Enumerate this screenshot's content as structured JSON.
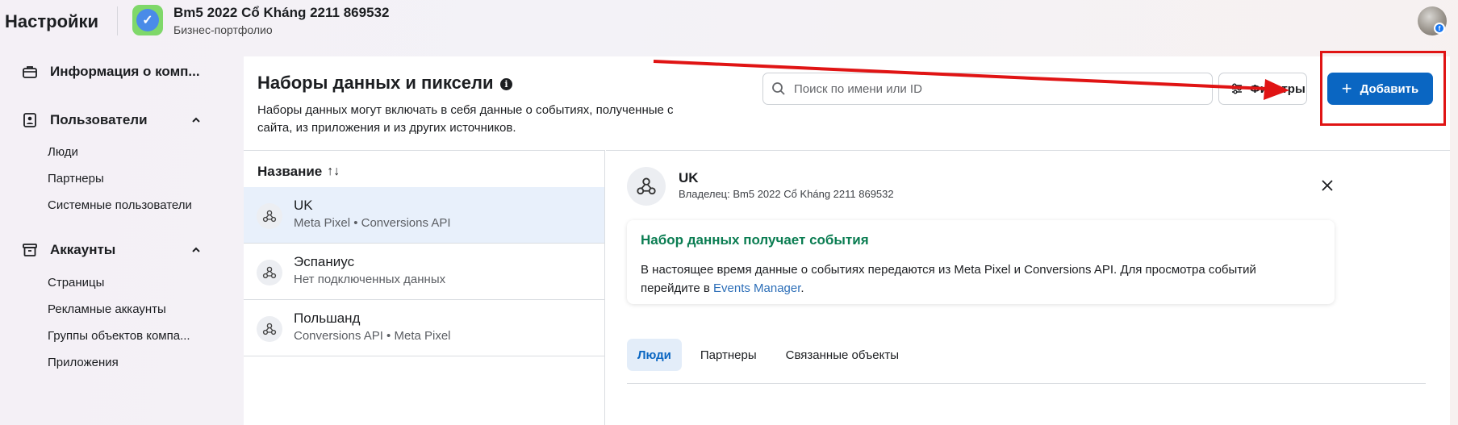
{
  "header": {
    "app_title": "Настройки",
    "business_name": "Bm5 2022 Cổ Kháng 2211 869532",
    "business_subtitle": "Бизнес-портфолио"
  },
  "sidebar": {
    "company_info": "Информация о комп...",
    "users": {
      "label": "Пользователи",
      "items": [
        "Люди",
        "Партнеры",
        "Системные пользователи"
      ]
    },
    "accounts": {
      "label": "Аккаунты",
      "items": [
        "Страницы",
        "Рекламные аккаунты",
        "Группы объектов компа...",
        "Приложения"
      ]
    }
  },
  "main": {
    "title": "Наборы данных и пиксели",
    "description": "Наборы данных могут включать в себя данные о событиях, полученные с сайта, из приложения и из других источников.",
    "search_placeholder": "Поиск по имени или ID",
    "filters_label": "Фильтры",
    "add_label": "Добавить",
    "add_plus": "+"
  },
  "list": {
    "column_header": "Название",
    "sort_glyph": "↑↓",
    "rows": [
      {
        "title": "UK",
        "subtitle": "Meta Pixel • Conversions API"
      },
      {
        "title": "Эспаниус",
        "subtitle": "Нет подключенных данных"
      },
      {
        "title": "Польшанд",
        "subtitle": "Conversions API • Meta Pixel"
      }
    ]
  },
  "detail": {
    "title": "UK",
    "owner": "Владелец: Bm5 2022 Cổ Kháng 2211 869532",
    "status_title": "Набор данных получает события",
    "status_text": "В настоящее время данные о событиях передаются из Meta Pixel и Conversions API. Для просмотра событий перейдите в",
    "status_link": "Events Manager",
    "status_end": ".",
    "tabs": [
      "Люди",
      "Партнеры",
      "Связанные объекты"
    ]
  },
  "colors": {
    "primary_button": "#0a66c2",
    "status_green": "#0b7d52",
    "annotation_red": "#e01414",
    "selected_row": "#e8f0fb"
  }
}
